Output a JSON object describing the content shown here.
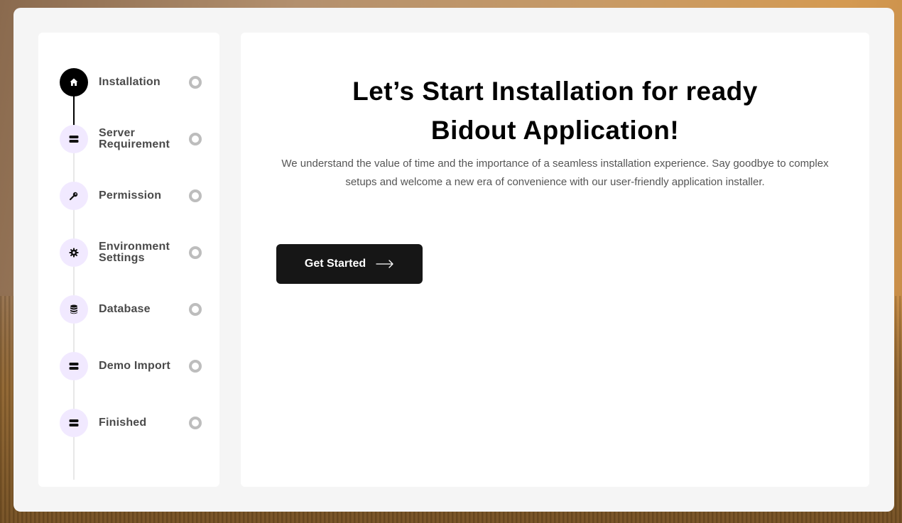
{
  "steps": [
    {
      "label": "Installation",
      "icon": "home-icon",
      "active": true
    },
    {
      "label": "Server Requirement",
      "icon": "server-icon",
      "active": false
    },
    {
      "label": "Permission",
      "icon": "key-icon",
      "active": false
    },
    {
      "label": "Environment Settings",
      "icon": "gear-icon",
      "active": false
    },
    {
      "label": "Database",
      "icon": "database-icon",
      "active": false
    },
    {
      "label": "Demo Import",
      "icon": "server-icon",
      "active": false
    },
    {
      "label": "Finished",
      "icon": "server-icon",
      "active": false
    }
  ],
  "main": {
    "title_line1": "Let’s Start Installation for ready",
    "title_line2": "Bidout Application!",
    "description": "We understand the value of time and the importance of a seamless installation experience. Say goodbye to complex setups and welcome a new era of convenience with our user-friendly application installer.",
    "button_label": "Get Started"
  },
  "colors": {
    "active_step": "#000000",
    "inactive_step_bg": "#f1e9ff",
    "button_bg": "#161616"
  }
}
